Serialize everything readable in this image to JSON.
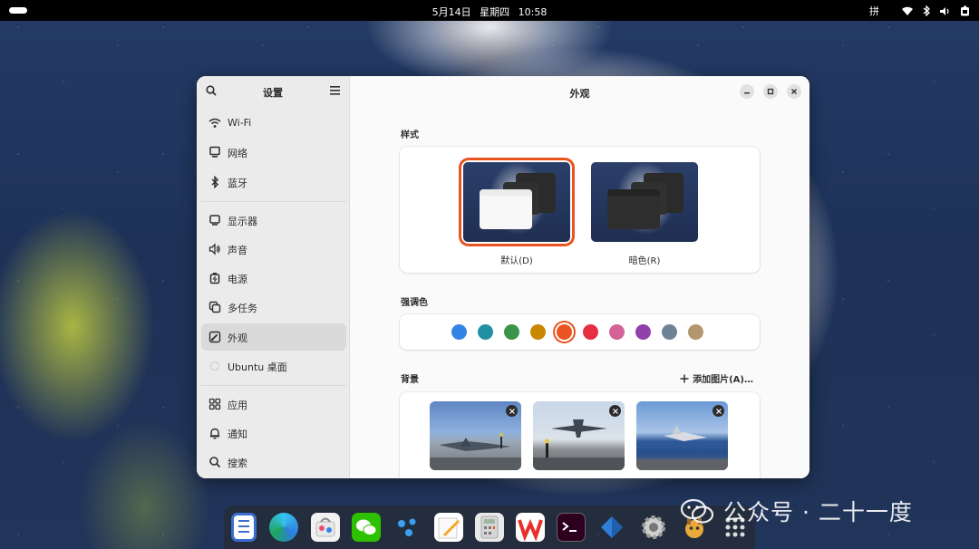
{
  "topbar": {
    "date": "5月14日",
    "weekday": "星期四",
    "time": "10:58",
    "input_method": "拼"
  },
  "sidebar": {
    "title": "设置",
    "items": [
      {
        "label": "Wi-Fi",
        "icon": "wifi-icon"
      },
      {
        "label": "网络",
        "icon": "network-icon"
      },
      {
        "label": "蓝牙",
        "icon": "bluetooth-icon"
      },
      {
        "label": "显示器",
        "icon": "display-icon"
      },
      {
        "label": "声音",
        "icon": "sound-icon"
      },
      {
        "label": "电源",
        "icon": "power-icon"
      },
      {
        "label": "多任务",
        "icon": "multitasking-icon"
      },
      {
        "label": "外观",
        "icon": "appearance-icon",
        "active": true
      },
      {
        "label": "Ubuntu 桌面",
        "icon": "ubuntu-icon"
      },
      {
        "label": "应用",
        "icon": "apps-icon"
      },
      {
        "label": "通知",
        "icon": "bell-icon"
      },
      {
        "label": "搜索",
        "icon": "search-icon"
      }
    ]
  },
  "content": {
    "title": "外观",
    "style": {
      "label": "样式",
      "options": [
        {
          "name": "默认(D)",
          "selected": true
        },
        {
          "name": "暗色(R)",
          "selected": false
        }
      ]
    },
    "accent": {
      "label": "强调色",
      "selected_index": 4,
      "colors": [
        "#3584e4",
        "#2190a4",
        "#3a944a",
        "#c88800",
        "#e95420",
        "#e62d42",
        "#d56199",
        "#9141ac",
        "#6f8396",
        "#b29670"
      ]
    },
    "background": {
      "label": "背景",
      "add_label": "添加图片(A)…",
      "thumbnails": [
        "fighter-jet-on-deck",
        "jet-launch",
        "jet-takeoff"
      ]
    }
  },
  "dock": {
    "apps": [
      "notes",
      "edge",
      "software-store",
      "wechat",
      "dots-app",
      "text-editor",
      "calculator",
      "wps",
      "terminal",
      "vscode-like",
      "settings",
      "gimp-like",
      "app-grid"
    ]
  },
  "watermark": {
    "text": "公众号 · 二十一度"
  }
}
